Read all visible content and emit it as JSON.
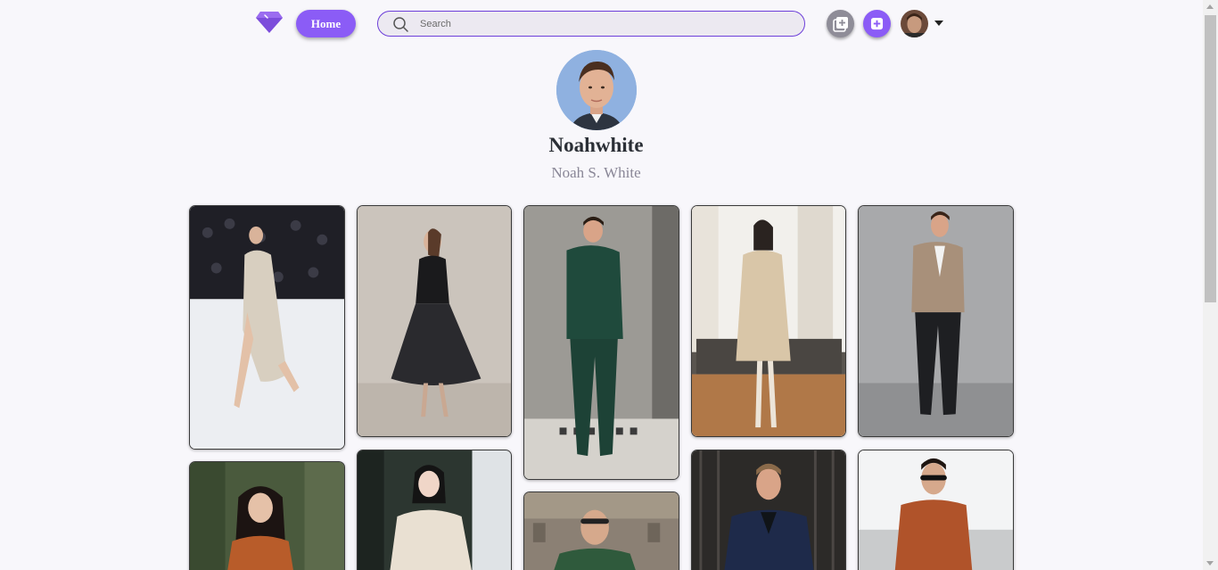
{
  "header": {
    "home_label": "Home",
    "search_placeholder": "Search",
    "accent_color": "#8b5cf6"
  },
  "profile": {
    "username": "Noahwhite",
    "full_name": "Noah S. White"
  },
  "pins": [
    {
      "name": "pin-runway-satin-dress"
    },
    {
      "name": "pin-black-tulle-dress"
    },
    {
      "name": "pin-green-suit"
    },
    {
      "name": "pin-beige-coat"
    },
    {
      "name": "pin-tan-blazer"
    },
    {
      "name": "pin-orange-sweater"
    },
    {
      "name": "pin-cream-coat"
    },
    {
      "name": "pin-green-shirt"
    },
    {
      "name": "pin-navy-blazer"
    },
    {
      "name": "pin-rust-shirt"
    }
  ]
}
